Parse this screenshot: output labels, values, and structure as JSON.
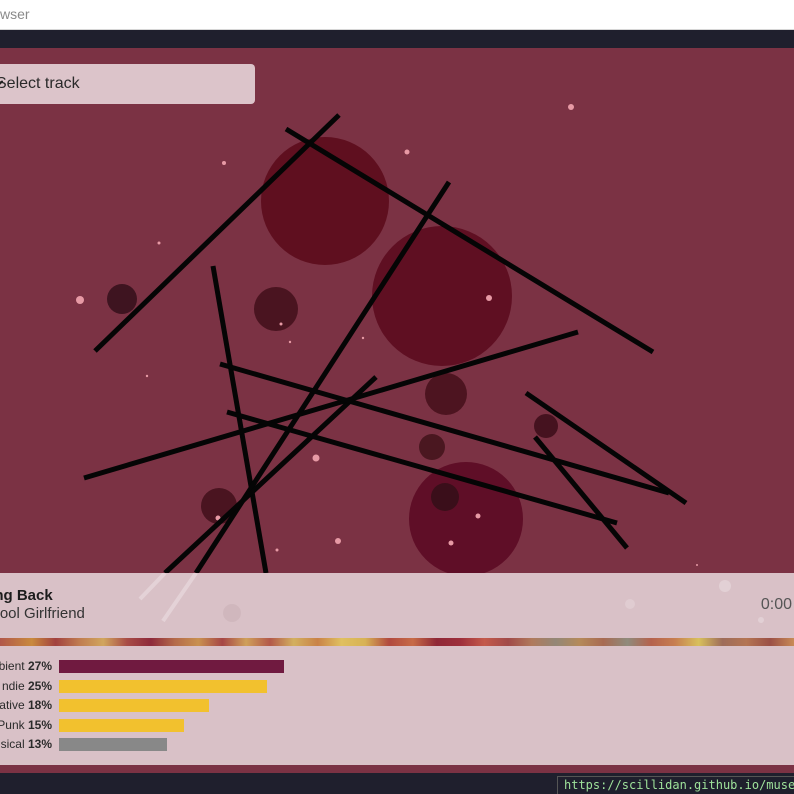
{
  "browser": {
    "address_text": "wser"
  },
  "track_select": {
    "label": "Select track",
    "icon": "chevron-down-icon"
  },
  "player": {
    "title": "ling Back",
    "artist": "chool Girlfriend",
    "time": "0:00"
  },
  "genres": [
    {
      "name": "bient",
      "percent": "27%",
      "value": 27,
      "color": "#701a40"
    },
    {
      "name": "ndie",
      "percent": "25%",
      "value": 25,
      "color": "#f2c12e"
    },
    {
      "name": "ative",
      "percent": "18%",
      "value": 18,
      "color": "#f2c12e"
    },
    {
      "name": "Punk",
      "percent": "15%",
      "value": 15,
      "color": "#f2c12e"
    },
    {
      "name": "sical",
      "percent": "13%",
      "value": 13,
      "color": "#888888"
    }
  ],
  "status_bar": {
    "url": "https://scillidan.github.io/muse"
  },
  "colors": {
    "background": "#7b3244",
    "panel": "#d9c1c7",
    "dark": "#1f1f2d"
  }
}
